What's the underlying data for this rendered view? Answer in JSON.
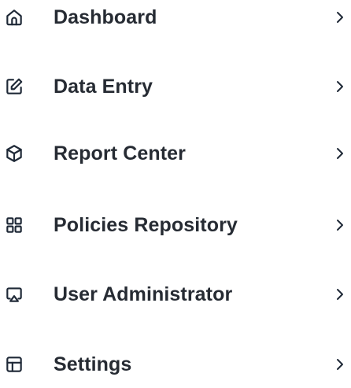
{
  "menu": {
    "items": [
      {
        "label": "Dashboard",
        "icon": "home-icon"
      },
      {
        "label": "Data Entry",
        "icon": "edit-icon"
      },
      {
        "label": "Report Center",
        "icon": "cube-icon"
      },
      {
        "label": "Policies Repository",
        "icon": "grid-icon"
      },
      {
        "label": "User Administrator",
        "icon": "airplay-icon"
      },
      {
        "label": "Settings",
        "icon": "layout-icon"
      }
    ],
    "chevron_icon": "chevron-right-icon"
  },
  "colors": {
    "text": "#262b33",
    "icon": "#1f2937",
    "background": "#ffffff"
  }
}
